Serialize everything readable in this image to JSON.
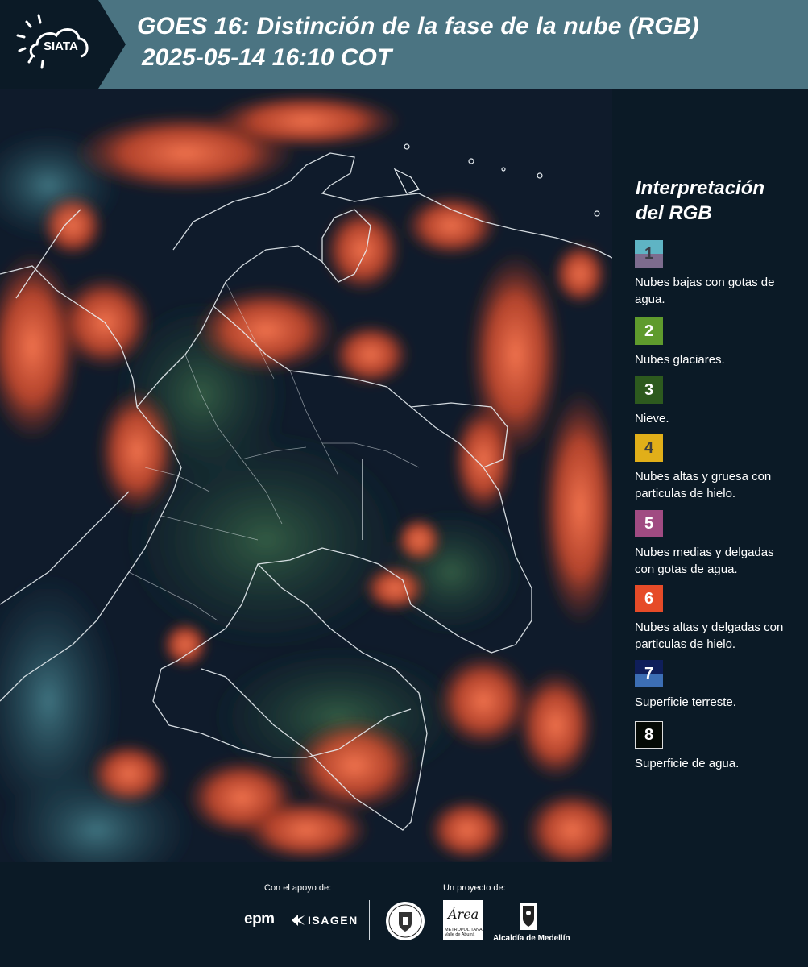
{
  "header": {
    "logo_text": "SIATA",
    "title_line1": "GOES 16: Distinción de la fase de la nube (RGB)",
    "title_line2": "2025-05-14 16:10 COT"
  },
  "map": {
    "description_icon": "satellite-rgb-image"
  },
  "legend": {
    "title": "Interpretación del RGB",
    "items": [
      {
        "number": "1",
        "label": "Nubes bajas con gotas de agua.",
        "color_top": "#5fb4c4",
        "color_bottom": "#7d6c8e",
        "num_color": "#3c3c46"
      },
      {
        "number": "2",
        "label": "Nubes glaciares.",
        "color_top": "#5f9b2d",
        "color_bottom": "#5f9b2d",
        "num_color": "#ffffff"
      },
      {
        "number": "3",
        "label": "Nieve.",
        "color_top": "#2d5a1e",
        "color_bottom": "#2d5a1e",
        "num_color": "#ffffff"
      },
      {
        "number": "4",
        "label": "Nubes altas y gruesa con particulas de hielo.",
        "color_top": "#e1af19",
        "color_bottom": "#e1af19",
        "num_color": "#3c3c3c"
      },
      {
        "number": "5",
        "label": "Nubes medias y delgadas con gotas de agua.",
        "color_top": "#a04b82",
        "color_bottom": "#a04b82",
        "num_color": "#ffffff"
      },
      {
        "number": "6",
        "label": "Nubes altas y delgadas con particulas de hielo.",
        "color_top": "#e64b28",
        "color_bottom": "#e64b28",
        "num_color": "#ffffff"
      },
      {
        "number": "7",
        "label": "Superficie terreste.",
        "color_top": "#0f1e5a",
        "color_bottom": "#3c6eb4",
        "num_color": "#ffffff"
      },
      {
        "number": "8",
        "label": "Superficie de agua.",
        "color_top": "#050a05",
        "color_bottom": "#050a05",
        "num_color": "#ffffff"
      }
    ]
  },
  "footer": {
    "support_label": "Con el apoyo de:",
    "project_label": "Un proyecto de:",
    "epm_text": "epm",
    "isagen_text": "ISAGEN",
    "area_word": "Área",
    "area_sub": "METROPOLITANA Valle de Aburrá",
    "alcaldia_text": "Alcaldía de Medellín"
  }
}
